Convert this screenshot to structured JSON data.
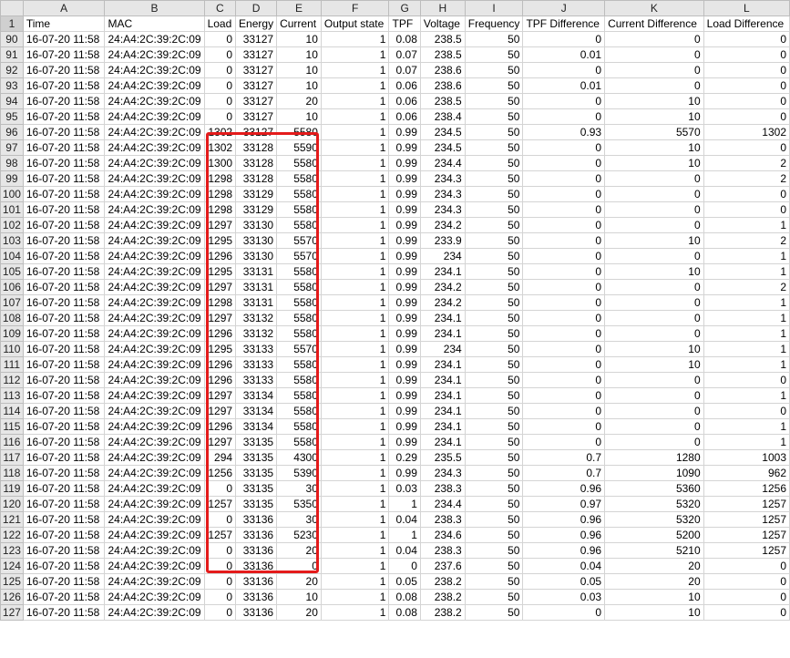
{
  "columns": [
    "A",
    "B",
    "C",
    "D",
    "E",
    "F",
    "G",
    "H",
    "I",
    "J",
    "K",
    "L"
  ],
  "header_row": {
    "number": "1",
    "cells": [
      "Time",
      "MAC",
      "Load",
      "Energy",
      "Current",
      "Output state",
      "TPF",
      "Voltage",
      "Frequency",
      "TPF Difference",
      "Current Difference",
      "Load Difference"
    ]
  },
  "rows": [
    {
      "n": "90",
      "cells": [
        "16-07-20 11:58",
        "24:A4:2C:39:2C:09",
        "0",
        "33127",
        "10",
        "1",
        "0.08",
        "238.5",
        "50",
        "0",
        "0",
        "0"
      ]
    },
    {
      "n": "91",
      "cells": [
        "16-07-20 11:58",
        "24:A4:2C:39:2C:09",
        "0",
        "33127",
        "10",
        "1",
        "0.07",
        "238.5",
        "50",
        "0.01",
        "0",
        "0"
      ]
    },
    {
      "n": "92",
      "cells": [
        "16-07-20 11:58",
        "24:A4:2C:39:2C:09",
        "0",
        "33127",
        "10",
        "1",
        "0.07",
        "238.6",
        "50",
        "0",
        "0",
        "0"
      ]
    },
    {
      "n": "93",
      "cells": [
        "16-07-20 11:58",
        "24:A4:2C:39:2C:09",
        "0",
        "33127",
        "10",
        "1",
        "0.06",
        "238.6",
        "50",
        "0.01",
        "0",
        "0"
      ]
    },
    {
      "n": "94",
      "cells": [
        "16-07-20 11:58",
        "24:A4:2C:39:2C:09",
        "0",
        "33127",
        "20",
        "1",
        "0.06",
        "238.5",
        "50",
        "0",
        "10",
        "0"
      ]
    },
    {
      "n": "95",
      "cells": [
        "16-07-20 11:58",
        "24:A4:2C:39:2C:09",
        "0",
        "33127",
        "10",
        "1",
        "0.06",
        "238.4",
        "50",
        "0",
        "10",
        "0"
      ]
    },
    {
      "n": "96",
      "cells": [
        "16-07-20 11:58",
        "24:A4:2C:39:2C:09",
        "1302",
        "33127",
        "5580",
        "1",
        "0.99",
        "234.5",
        "50",
        "0.93",
        "5570",
        "1302"
      ]
    },
    {
      "n": "97",
      "cells": [
        "16-07-20 11:58",
        "24:A4:2C:39:2C:09",
        "1302",
        "33128",
        "5590",
        "1",
        "0.99",
        "234.5",
        "50",
        "0",
        "10",
        "0"
      ]
    },
    {
      "n": "98",
      "cells": [
        "16-07-20 11:58",
        "24:A4:2C:39:2C:09",
        "1300",
        "33128",
        "5580",
        "1",
        "0.99",
        "234.4",
        "50",
        "0",
        "10",
        "2"
      ]
    },
    {
      "n": "99",
      "cells": [
        "16-07-20 11:58",
        "24:A4:2C:39:2C:09",
        "1298",
        "33128",
        "5580",
        "1",
        "0.99",
        "234.3",
        "50",
        "0",
        "0",
        "2"
      ]
    },
    {
      "n": "100",
      "cells": [
        "16-07-20 11:58",
        "24:A4:2C:39:2C:09",
        "1298",
        "33129",
        "5580",
        "1",
        "0.99",
        "234.3",
        "50",
        "0",
        "0",
        "0"
      ]
    },
    {
      "n": "101",
      "cells": [
        "16-07-20 11:58",
        "24:A4:2C:39:2C:09",
        "1298",
        "33129",
        "5580",
        "1",
        "0.99",
        "234.3",
        "50",
        "0",
        "0",
        "0"
      ]
    },
    {
      "n": "102",
      "cells": [
        "16-07-20 11:58",
        "24:A4:2C:39:2C:09",
        "1297",
        "33130",
        "5580",
        "1",
        "0.99",
        "234.2",
        "50",
        "0",
        "0",
        "1"
      ]
    },
    {
      "n": "103",
      "cells": [
        "16-07-20 11:58",
        "24:A4:2C:39:2C:09",
        "1295",
        "33130",
        "5570",
        "1",
        "0.99",
        "233.9",
        "50",
        "0",
        "10",
        "2"
      ]
    },
    {
      "n": "104",
      "cells": [
        "16-07-20 11:58",
        "24:A4:2C:39:2C:09",
        "1296",
        "33130",
        "5570",
        "1",
        "0.99",
        "234",
        "50",
        "0",
        "0",
        "1"
      ]
    },
    {
      "n": "105",
      "cells": [
        "16-07-20 11:58",
        "24:A4:2C:39:2C:09",
        "1295",
        "33131",
        "5580",
        "1",
        "0.99",
        "234.1",
        "50",
        "0",
        "10",
        "1"
      ]
    },
    {
      "n": "106",
      "cells": [
        "16-07-20 11:58",
        "24:A4:2C:39:2C:09",
        "1297",
        "33131",
        "5580",
        "1",
        "0.99",
        "234.2",
        "50",
        "0",
        "0",
        "2"
      ]
    },
    {
      "n": "107",
      "cells": [
        "16-07-20 11:58",
        "24:A4:2C:39:2C:09",
        "1298",
        "33131",
        "5580",
        "1",
        "0.99",
        "234.2",
        "50",
        "0",
        "0",
        "1"
      ]
    },
    {
      "n": "108",
      "cells": [
        "16-07-20 11:58",
        "24:A4:2C:39:2C:09",
        "1297",
        "33132",
        "5580",
        "1",
        "0.99",
        "234.1",
        "50",
        "0",
        "0",
        "1"
      ]
    },
    {
      "n": "109",
      "cells": [
        "16-07-20 11:58",
        "24:A4:2C:39:2C:09",
        "1296",
        "33132",
        "5580",
        "1",
        "0.99",
        "234.1",
        "50",
        "0",
        "0",
        "1"
      ]
    },
    {
      "n": "110",
      "cells": [
        "16-07-20 11:58",
        "24:A4:2C:39:2C:09",
        "1295",
        "33133",
        "5570",
        "1",
        "0.99",
        "234",
        "50",
        "0",
        "10",
        "1"
      ]
    },
    {
      "n": "111",
      "cells": [
        "16-07-20 11:58",
        "24:A4:2C:39:2C:09",
        "1296",
        "33133",
        "5580",
        "1",
        "0.99",
        "234.1",
        "50",
        "0",
        "10",
        "1"
      ]
    },
    {
      "n": "112",
      "cells": [
        "16-07-20 11:58",
        "24:A4:2C:39:2C:09",
        "1296",
        "33133",
        "5580",
        "1",
        "0.99",
        "234.1",
        "50",
        "0",
        "0",
        "0"
      ]
    },
    {
      "n": "113",
      "cells": [
        "16-07-20 11:58",
        "24:A4:2C:39:2C:09",
        "1297",
        "33134",
        "5580",
        "1",
        "0.99",
        "234.1",
        "50",
        "0",
        "0",
        "1"
      ]
    },
    {
      "n": "114",
      "cells": [
        "16-07-20 11:58",
        "24:A4:2C:39:2C:09",
        "1297",
        "33134",
        "5580",
        "1",
        "0.99",
        "234.1",
        "50",
        "0",
        "0",
        "0"
      ]
    },
    {
      "n": "115",
      "cells": [
        "16-07-20 11:58",
        "24:A4:2C:39:2C:09",
        "1296",
        "33134",
        "5580",
        "1",
        "0.99",
        "234.1",
        "50",
        "0",
        "0",
        "1"
      ]
    },
    {
      "n": "116",
      "cells": [
        "16-07-20 11:58",
        "24:A4:2C:39:2C:09",
        "1297",
        "33135",
        "5580",
        "1",
        "0.99",
        "234.1",
        "50",
        "0",
        "0",
        "1"
      ]
    },
    {
      "n": "117",
      "cells": [
        "16-07-20 11:58",
        "24:A4:2C:39:2C:09",
        "294",
        "33135",
        "4300",
        "1",
        "0.29",
        "235.5",
        "50",
        "0.7",
        "1280",
        "1003"
      ]
    },
    {
      "n": "118",
      "cells": [
        "16-07-20 11:58",
        "24:A4:2C:39:2C:09",
        "1256",
        "33135",
        "5390",
        "1",
        "0.99",
        "234.3",
        "50",
        "0.7",
        "1090",
        "962"
      ]
    },
    {
      "n": "119",
      "cells": [
        "16-07-20 11:58",
        "24:A4:2C:39:2C:09",
        "0",
        "33135",
        "30",
        "1",
        "0.03",
        "238.3",
        "50",
        "0.96",
        "5360",
        "1256"
      ]
    },
    {
      "n": "120",
      "cells": [
        "16-07-20 11:58",
        "24:A4:2C:39:2C:09",
        "1257",
        "33135",
        "5350",
        "1",
        "1",
        "234.4",
        "50",
        "0.97",
        "5320",
        "1257"
      ]
    },
    {
      "n": "121",
      "cells": [
        "16-07-20 11:58",
        "24:A4:2C:39:2C:09",
        "0",
        "33136",
        "30",
        "1",
        "0.04",
        "238.3",
        "50",
        "0.96",
        "5320",
        "1257"
      ]
    },
    {
      "n": "122",
      "cells": [
        "16-07-20 11:58",
        "24:A4:2C:39:2C:09",
        "1257",
        "33136",
        "5230",
        "1",
        "1",
        "234.6",
        "50",
        "0.96",
        "5200",
        "1257"
      ]
    },
    {
      "n": "123",
      "cells": [
        "16-07-20 11:58",
        "24:A4:2C:39:2C:09",
        "0",
        "33136",
        "20",
        "1",
        "0.04",
        "238.3",
        "50",
        "0.96",
        "5210",
        "1257"
      ]
    },
    {
      "n": "124",
      "cells": [
        "16-07-20 11:58",
        "24:A4:2C:39:2C:09",
        "0",
        "33136",
        "0",
        "1",
        "0",
        "237.6",
        "50",
        "0.04",
        "20",
        "0"
      ]
    },
    {
      "n": "125",
      "cells": [
        "16-07-20 11:58",
        "24:A4:2C:39:2C:09",
        "0",
        "33136",
        "20",
        "1",
        "0.05",
        "238.2",
        "50",
        "0.05",
        "20",
        "0"
      ]
    },
    {
      "n": "126",
      "cells": [
        "16-07-20 11:58",
        "24:A4:2C:39:2C:09",
        "0",
        "33136",
        "10",
        "1",
        "0.08",
        "238.2",
        "50",
        "0.03",
        "10",
        "0"
      ]
    },
    {
      "n": "127",
      "cells": [
        "16-07-20 11:58",
        "24:A4:2C:39:2C:09",
        "0",
        "33136",
        "20",
        "1",
        "0.08",
        "238.2",
        "50",
        "0",
        "10",
        "0"
      ]
    }
  ],
  "highlight": {
    "columns": [
      "C",
      "D",
      "E"
    ],
    "first_row": "96",
    "last_row": "122",
    "color": "#e41b1b"
  },
  "colors": {
    "header_bg": "#e6e6e6",
    "gridline": "#d4d4d4"
  }
}
